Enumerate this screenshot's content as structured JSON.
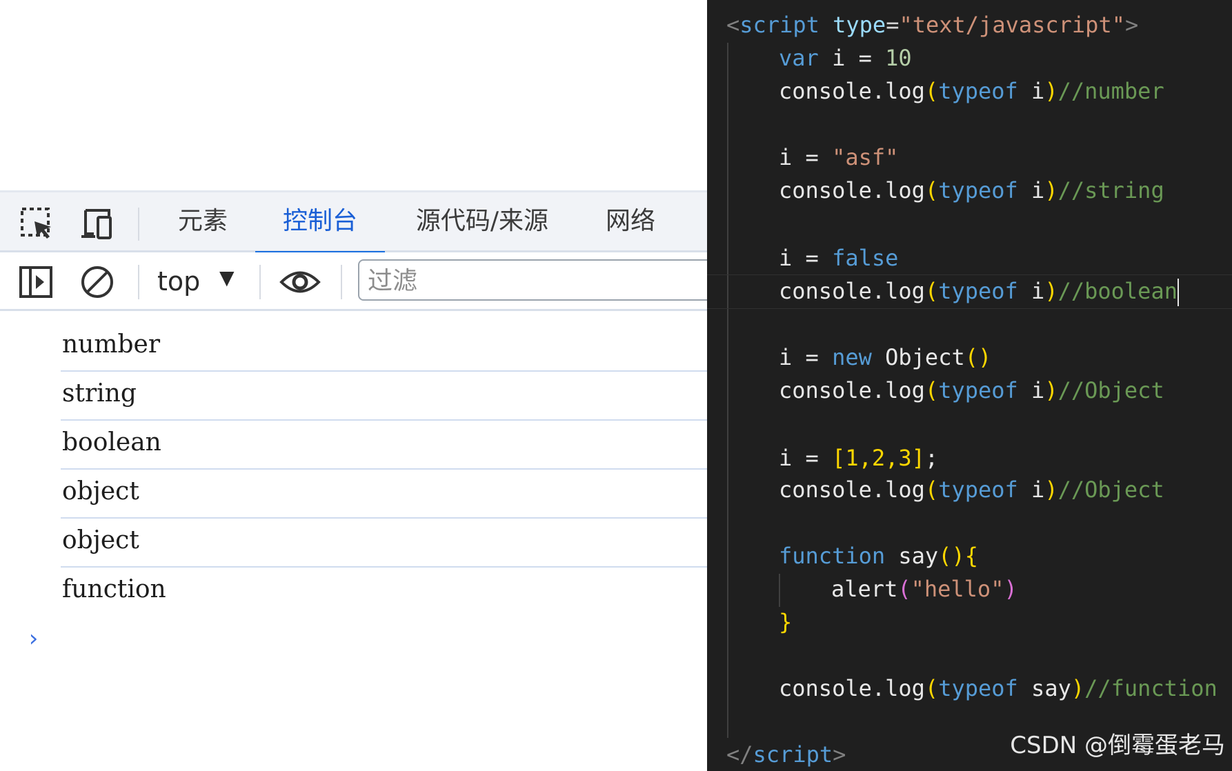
{
  "devtools": {
    "tabs": [
      {
        "label": "元素",
        "active": false
      },
      {
        "label": "控制台",
        "active": true
      },
      {
        "label": "源代码/来源",
        "active": false
      },
      {
        "label": "网络",
        "active": false
      }
    ],
    "toolbar": {
      "context": "top",
      "filter_placeholder": "过滤"
    },
    "console_output": [
      "number",
      "string",
      "boolean",
      "object",
      "object",
      "function"
    ],
    "prompt": "›"
  },
  "editor": {
    "lines": {
      "l1_open": "<",
      "l1_tag": "script",
      "l1_attr": "type",
      "l1_eq": "=",
      "l1_val": "\"text/javascript\"",
      "l1_close": ">",
      "l2_kw": "var",
      "l2_rest": " i = ",
      "l2_num": "10",
      "log_obj": "console",
      "log_dot": ".",
      "log_fn": "log",
      "typeof_kw": "typeof",
      "var_i": "i",
      "c_number": "//number",
      "l5_lhs": "i = ",
      "l5_str": "\"asf\"",
      "c_string": "//string",
      "l8_lhs": "i = ",
      "l8_val": "false",
      "c_boolean": "//boolean",
      "l11_lhs": "i = ",
      "l11_new": "new",
      "l11_cls": "Object",
      "c_object": "//Object",
      "l14_lhs": "i = ",
      "l14_arr": "[1,2,3]",
      "l14_semi": ";",
      "l17_kw": "function",
      "l17_name": "say",
      "l18_fn": "alert",
      "l18_str": "\"hello\"",
      "var_say": "say",
      "c_function": "//function",
      "end_tag": "script"
    }
  },
  "watermark": "CSDN @倒霉蛋老马"
}
